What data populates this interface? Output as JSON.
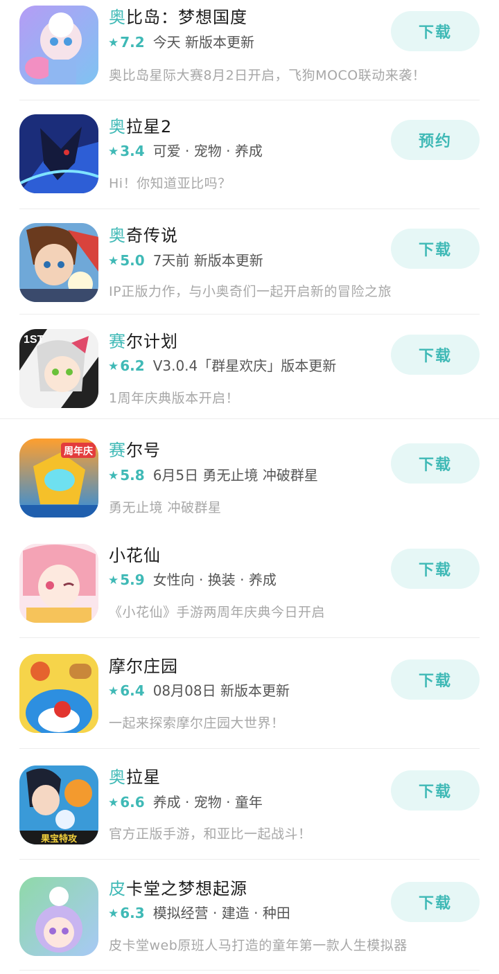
{
  "colors": {
    "accent": "#3fb9b6",
    "button_bg": "#e6f7f6",
    "desc": "#a7a7a7"
  },
  "games": [
    {
      "title_hl": "奥",
      "title_rest": "比岛：梦想国度",
      "score": "7.2",
      "tags": "今天 新版本更新",
      "desc": "奥比岛星际大赛8月2日开启，飞狗MOCO联动来袭！",
      "button": "下载",
      "icon": "obi-island-icon"
    },
    {
      "title_hl": "奥",
      "title_rest": "拉星2",
      "score": "3.4",
      "tags": "可爱 · 宠物 · 养成",
      "desc": "Hi！你知道亚比吗？",
      "button": "预约",
      "icon": "aola-star-2-icon"
    },
    {
      "title_hl": "奥",
      "title_rest": "奇传说",
      "score": "5.0",
      "tags": "7天前 新版本更新",
      "desc": "IP正版力作，与小奥奇们一起开启新的冒险之旅",
      "button": "下载",
      "icon": "aoqi-legend-icon"
    },
    {
      "title_hl": "赛",
      "title_rest": "尔计划",
      "score": "6.2",
      "tags": "V3.0.4「群星欢庆」版本更新",
      "desc": "1周年庆典版本开启！",
      "button": "下载",
      "icon": "seer-plan-icon"
    },
    {
      "title_hl": "赛",
      "title_rest": "尔号",
      "score": "5.8",
      "tags": "6月5日 勇无止境 冲破群星",
      "desc": "勇无止境 冲破群星",
      "button": "下载",
      "icon": "seer-icon"
    },
    {
      "title_hl": "",
      "title_rest": "小花仙",
      "score": "5.9",
      "tags": "女性向 · 换装 · 养成",
      "desc": "《小花仙》手游两周年庆典今日开启",
      "button": "下载",
      "icon": "little-flower-fairy-icon"
    },
    {
      "title_hl": "",
      "title_rest": "摩尔庄园",
      "score": "6.4",
      "tags": "08月08日 新版本更新",
      "desc": "一起来探索摩尔庄园大世界！",
      "button": "下载",
      "icon": "mole-manor-icon"
    },
    {
      "title_hl": "奥",
      "title_rest": "拉星",
      "score": "6.6",
      "tags": "养成 · 宠物 · 童年",
      "desc": "官方正版手游，和亚比一起战斗！",
      "button": "下载",
      "icon": "aola-star-icon"
    },
    {
      "title_hl": "皮",
      "title_rest": "卡堂之梦想起源",
      "score": "6.3",
      "tags": "模拟经营 · 建造 · 种田",
      "desc": "皮卡堂web原班人马打造的童年第一款人生模拟器",
      "button": "下载",
      "icon": "pikatang-icon"
    }
  ],
  "icon_texts": {
    "seer_plan_badge": "1ST",
    "seer_badge": "周年庆",
    "aola_badge": "果宝特攻"
  }
}
